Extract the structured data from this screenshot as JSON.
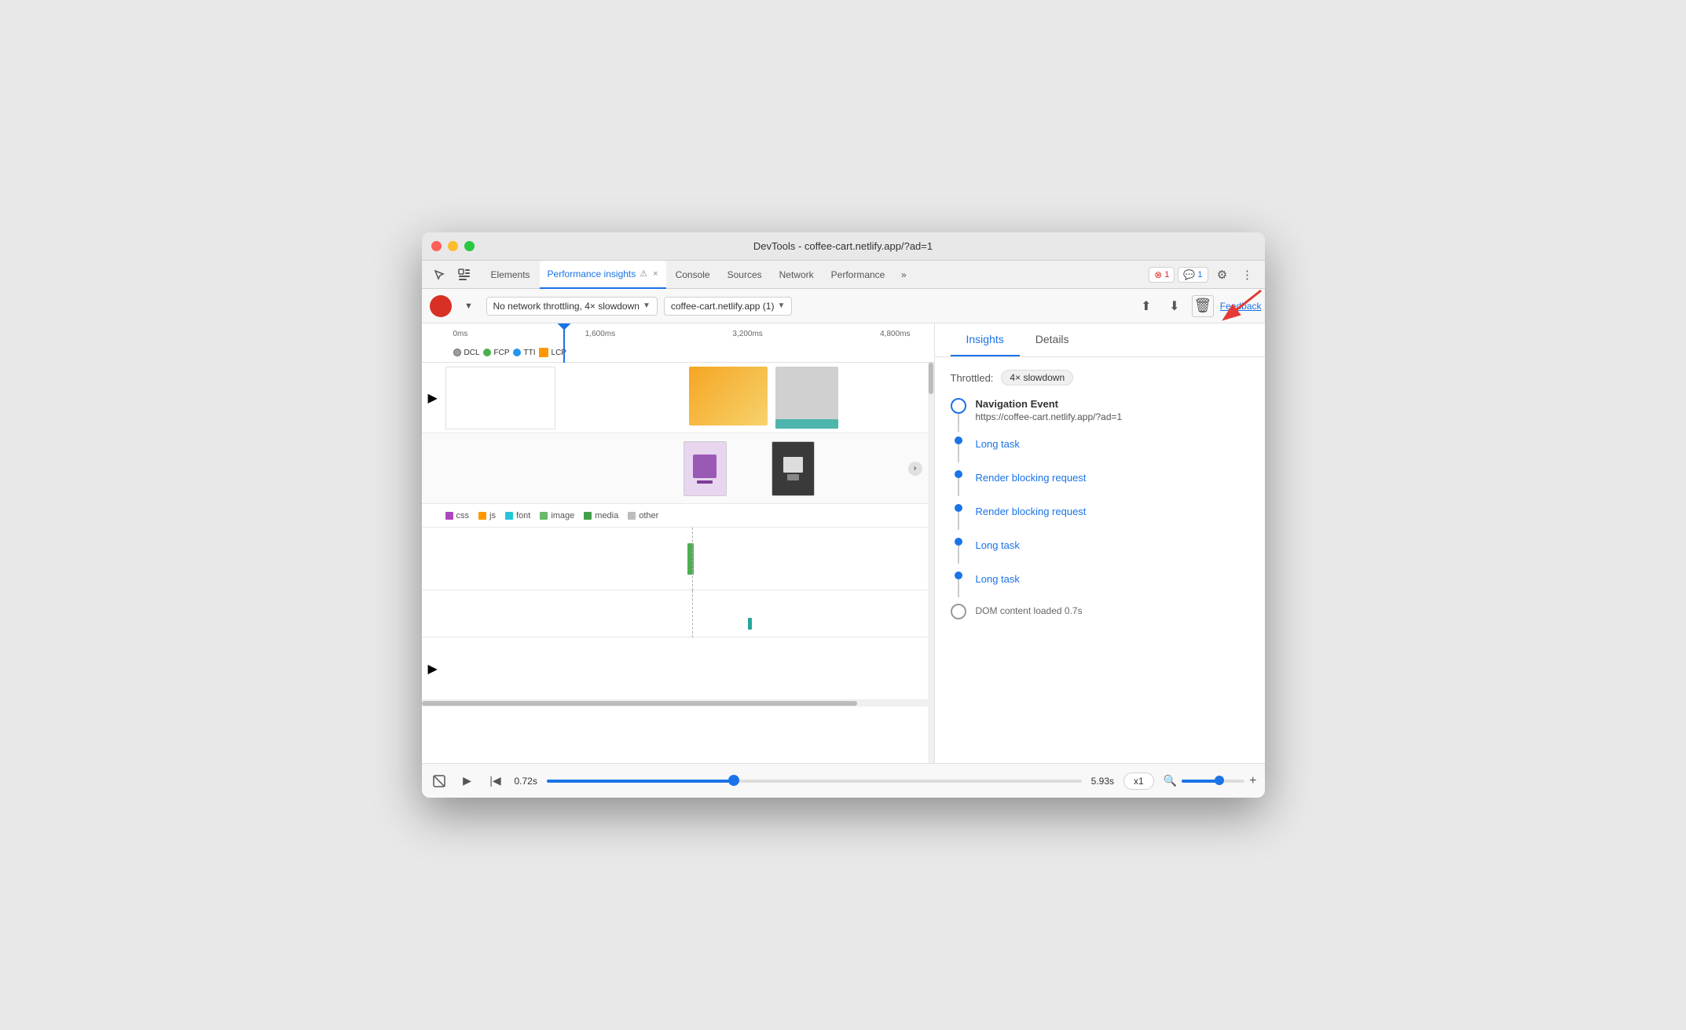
{
  "window": {
    "title": "DevTools - coffee-cart.netlify.app/?ad=1"
  },
  "tabs": {
    "items": [
      {
        "label": "Elements",
        "active": false,
        "closeable": false
      },
      {
        "label": "Performance insights",
        "active": true,
        "closeable": true
      },
      {
        "label": "Console",
        "active": false,
        "closeable": false
      },
      {
        "label": "Sources",
        "active": false,
        "closeable": false
      },
      {
        "label": "Network",
        "active": false,
        "closeable": false
      },
      {
        "label": "Performance",
        "active": false,
        "closeable": false
      }
    ],
    "more_label": "»"
  },
  "badges": {
    "error": "1",
    "message": "1"
  },
  "toolbar": {
    "throttle_label": "No network throttling, 4× slowdown",
    "url_label": "coffee-cart.netlify.app (1)",
    "feedback_label": "Feedback"
  },
  "timeline": {
    "markers": [
      "0ms",
      "1,600ms",
      "3,200ms",
      "4,800ms"
    ],
    "metrics": [
      {
        "label": "DCL",
        "color": "#9e9e9e"
      },
      {
        "label": "FCP",
        "color": "#4caf50"
      },
      {
        "label": "TTI",
        "color": "#2196f3"
      },
      {
        "label": "LCP",
        "color": "#ff9800"
      }
    ]
  },
  "legend": {
    "items": [
      {
        "label": "css",
        "color": "#ab47bc"
      },
      {
        "label": "js",
        "color": "#ff9800"
      },
      {
        "label": "font",
        "color": "#26c6da"
      },
      {
        "label": "image",
        "color": "#66bb6a"
      },
      {
        "label": "media",
        "color": "#43a047"
      },
      {
        "label": "other",
        "color": "#bdbdbd"
      }
    ]
  },
  "insights_panel": {
    "tabs": [
      "Insights",
      "Details"
    ],
    "active_tab": "Insights",
    "throttle_label": "Throttled:",
    "throttle_value": "4× slowdown",
    "nav_event": {
      "title": "Navigation Event",
      "url": "https://coffee-cart.netlify.app/?ad=1"
    },
    "items": [
      {
        "label": "Long task",
        "type": "link"
      },
      {
        "label": "Render blocking request",
        "type": "link"
      },
      {
        "label": "Render blocking request",
        "type": "link"
      },
      {
        "label": "Long task",
        "type": "link"
      },
      {
        "label": "Long task",
        "type": "link"
      }
    ],
    "dom_loaded": "DOM content loaded 0.7s"
  },
  "bottom_bar": {
    "time_start": "0.72s",
    "time_end": "5.93s",
    "speed": "x1",
    "progress": 35
  }
}
